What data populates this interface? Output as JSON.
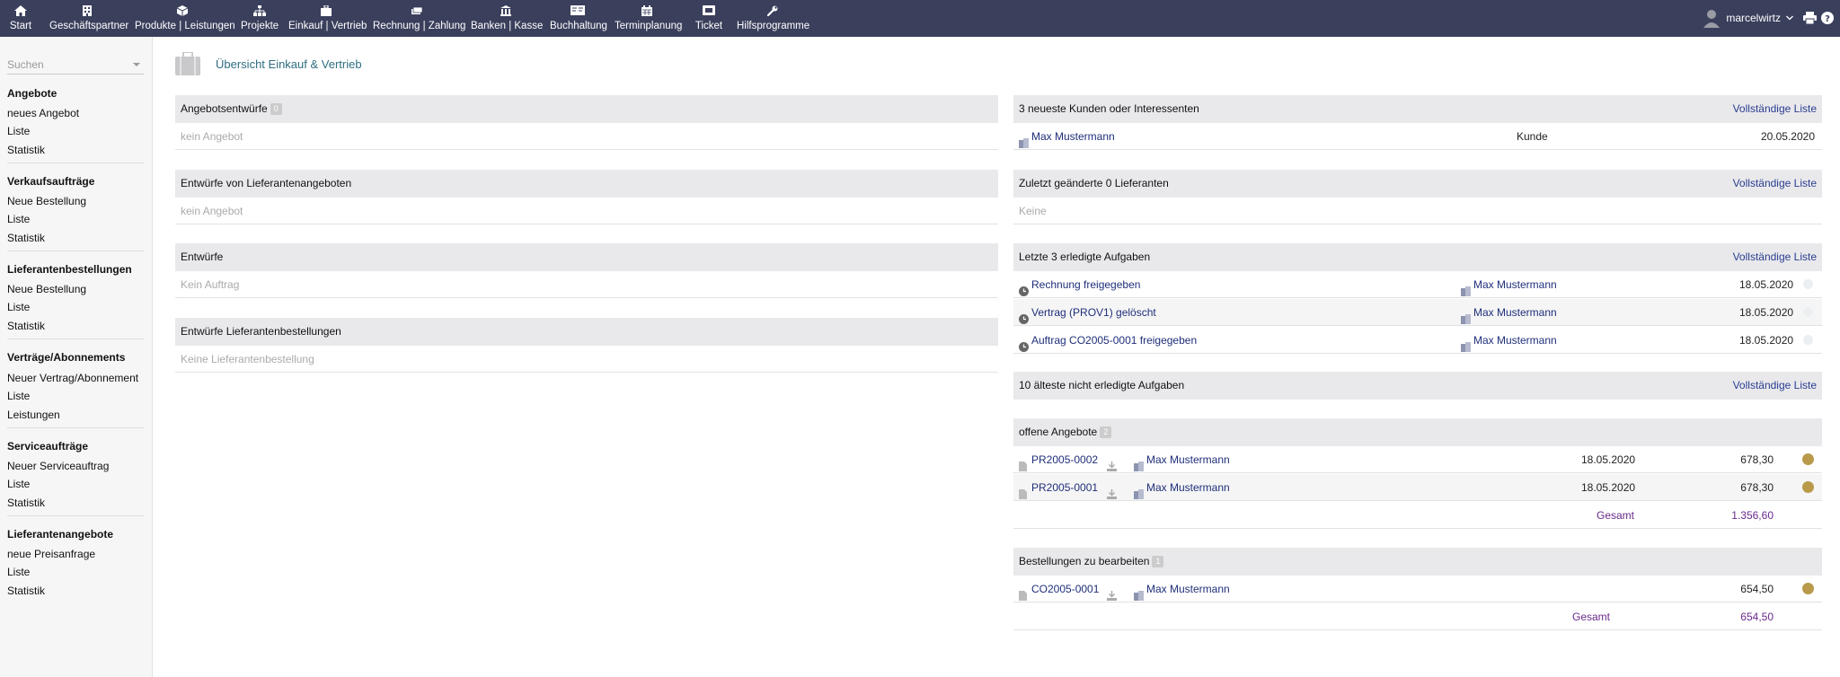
{
  "nav": {
    "items": [
      {
        "label": "Start",
        "icon": "home-icon"
      },
      {
        "label": "Geschäftspartner",
        "icon": "building-icon"
      },
      {
        "label": "Produkte | Leistungen",
        "icon": "cube-icon"
      },
      {
        "label": "Projekte",
        "icon": "sitemap-icon"
      },
      {
        "label": "Einkauf | Vertrieb",
        "icon": "briefcase-icon"
      },
      {
        "label": "Rechnung | Zahlung",
        "icon": "money-icon"
      },
      {
        "label": "Banken | Kasse",
        "icon": "bank-icon"
      },
      {
        "label": "Buchhaltung",
        "icon": "ledger-icon"
      },
      {
        "label": "Terminplanung",
        "icon": "calendar-icon"
      },
      {
        "label": "Ticket",
        "icon": "ticket-icon"
      },
      {
        "label": "Hilfsprogramme",
        "icon": "wrench-icon"
      }
    ],
    "username": "marcelwirtz"
  },
  "sidebar": {
    "search_placeholder": "Suchen",
    "sections": [
      {
        "title": "Angebote",
        "links": [
          "neues Angebot",
          "Liste",
          "Statistik"
        ]
      },
      {
        "title": "Verkaufsaufträge",
        "links": [
          "Neue Bestellung",
          "Liste",
          "Statistik"
        ]
      },
      {
        "title": "Lieferantenbestellungen",
        "links": [
          "Neue Bestellung",
          "Liste",
          "Statistik"
        ]
      },
      {
        "title": "Verträge/Abonnements",
        "links": [
          "Neuer Vertrag/Abonnement",
          "Liste",
          "Leistungen"
        ]
      },
      {
        "title": "Serviceaufträge",
        "links": [
          "Neuer Serviceauftrag",
          "Liste",
          "Statistik"
        ]
      },
      {
        "title": "Lieferantenangebote",
        "links": [
          "neue Preisanfrage",
          "Liste",
          "Statistik"
        ]
      }
    ]
  },
  "page": {
    "title": "Übersicht Einkauf & Vertrieb"
  },
  "left": {
    "boxes": [
      {
        "title": "Angebotsentwürfe",
        "badge": "0",
        "empty": "kein Angebot"
      },
      {
        "title": "Entwürfe von Lieferantenangeboten",
        "badge": "",
        "empty": "kein Angebot"
      },
      {
        "title": "Entwürfe",
        "badge": "",
        "empty": "Kein Auftrag"
      },
      {
        "title": "Entwürfe Lieferantenbestellungen",
        "badge": "",
        "empty": "Keine Lieferantenbestellung"
      }
    ]
  },
  "right": {
    "full_list": "Vollständige Liste",
    "customers": {
      "title": "3 neueste Kunden oder Interessenten",
      "rows": [
        {
          "name": "Max Mustermann",
          "type": "Kunde",
          "date": "20.05.2020"
        }
      ]
    },
    "suppliers": {
      "title": "Zuletzt geänderte 0 Lieferanten",
      "empty": "Keine"
    },
    "done_tasks": {
      "title": "Letzte 3 erledigte Aufgaben",
      "rows": [
        {
          "task": "Rechnung freigegeben",
          "partner": "Max Mustermann",
          "date": "18.05.2020"
        },
        {
          "task": "Vertrag (PROV1) gelöscht",
          "partner": "Max Mustermann",
          "date": "18.05.2020"
        },
        {
          "task": "Auftrag CO2005-0001 freigegeben",
          "partner": "Max Mustermann",
          "date": "18.05.2020"
        }
      ]
    },
    "open_tasks": {
      "title": "10 älteste nicht erledigte Aufgaben"
    },
    "offers": {
      "title": "offene Angebote",
      "badge": "2",
      "rows": [
        {
          "ref": "PR2005-0002",
          "partner": "Max Mustermann",
          "date": "18.05.2020",
          "amount": "678,30"
        },
        {
          "ref": "PR2005-0001",
          "partner": "Max Mustermann",
          "date": "18.05.2020",
          "amount": "678,30"
        }
      ],
      "total_label": "Gesamt",
      "total": "1.356,60"
    },
    "orders": {
      "title": "Bestellungen zu bearbeiten",
      "badge": "1",
      "rows": [
        {
          "ref": "CO2005-0001",
          "partner": "Max Mustermann",
          "amount": "654,50"
        }
      ],
      "total_label": "Gesamt",
      "total": "654,50"
    }
  },
  "colors": {
    "topbar": "#3a3f5c",
    "link": "#1f2f7a",
    "status_gold": "#b89a4a",
    "total": "#6a2a8c"
  }
}
